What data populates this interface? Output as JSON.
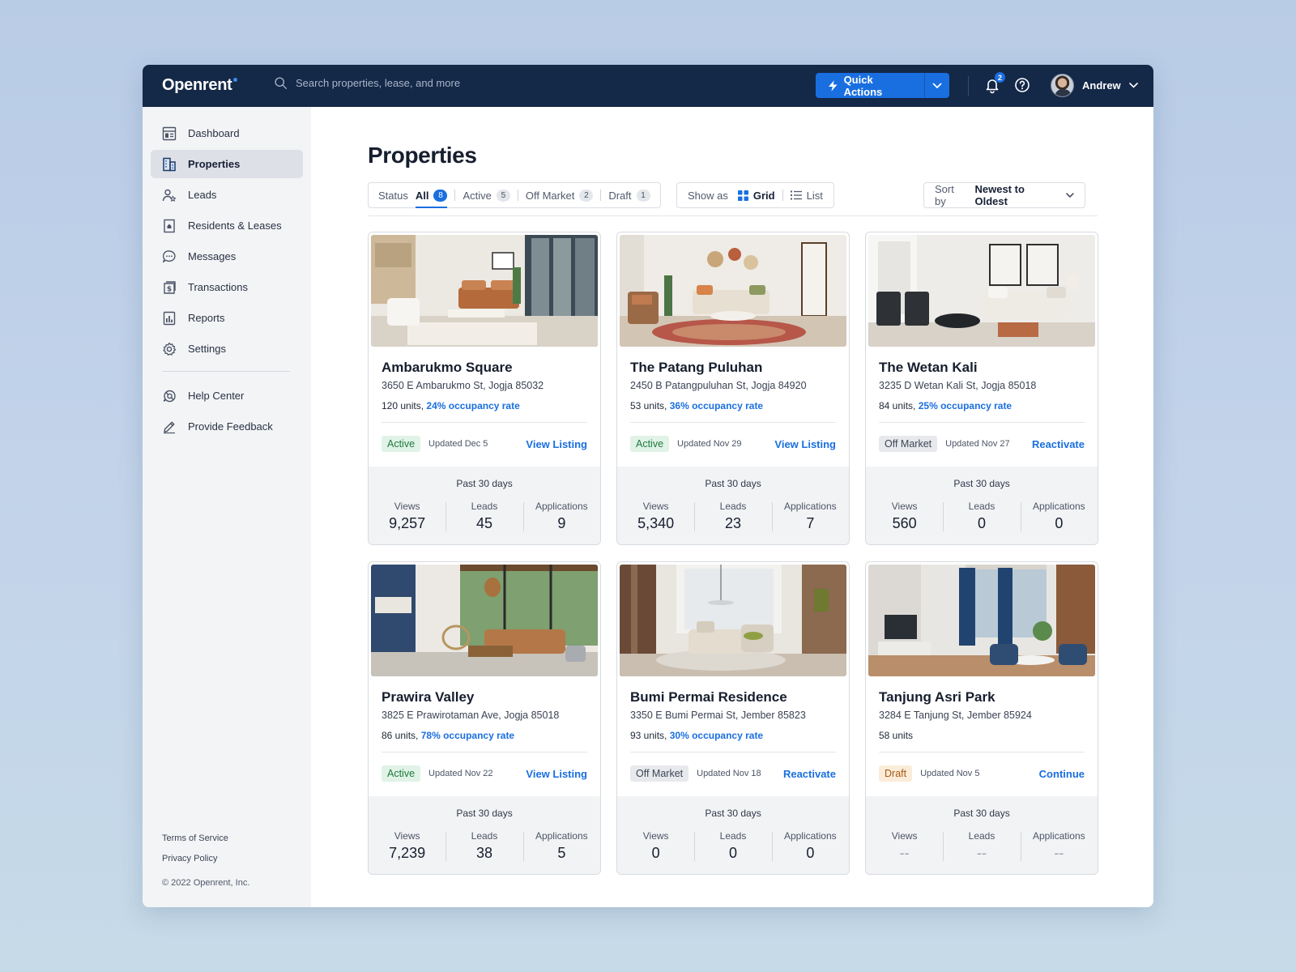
{
  "brand": {
    "name": "Openrent"
  },
  "search": {
    "placeholder": "Search properties, lease, and more"
  },
  "quick_actions": {
    "label": "Quick Actions"
  },
  "notifications": {
    "count": "2"
  },
  "user": {
    "name": "Andrew"
  },
  "sidebar": {
    "items": [
      {
        "label": "Dashboard",
        "icon": "dashboard-icon"
      },
      {
        "label": "Properties",
        "icon": "building-icon",
        "active": true
      },
      {
        "label": "Leads",
        "icon": "person-star-icon"
      },
      {
        "label": "Residents & Leases",
        "icon": "residence-icon"
      },
      {
        "label": "Messages",
        "icon": "chat-icon"
      },
      {
        "label": "Transactions",
        "icon": "dollar-icon"
      },
      {
        "label": "Reports",
        "icon": "report-icon"
      },
      {
        "label": "Settings",
        "icon": "gear-icon"
      }
    ],
    "secondary": [
      {
        "label": "Help Center",
        "icon": "help-center-icon"
      },
      {
        "label": "Provide Feedback",
        "icon": "pencil-icon"
      }
    ],
    "footer": {
      "terms": "Terms of Service",
      "privacy": "Privacy Policy",
      "copyright": "© 2022 Openrent, Inc."
    }
  },
  "page": {
    "title": "Properties",
    "status_label": "Status",
    "filters": [
      {
        "label": "All",
        "count": "8",
        "active": true
      },
      {
        "label": "Active",
        "count": "5"
      },
      {
        "label": "Off Market",
        "count": "2"
      },
      {
        "label": "Draft",
        "count": "1"
      }
    ],
    "show_as": {
      "label": "Show as",
      "grid": "Grid",
      "list": "List",
      "selected": "Grid"
    },
    "sort": {
      "label": "Sort by",
      "value": "Newest to Oldest"
    },
    "stats_period": "Past 30 days",
    "stat_labels": {
      "views": "Views",
      "leads": "Leads",
      "applications": "Applications"
    }
  },
  "properties": [
    {
      "name": "Ambarukmo Square",
      "address": "3650 E Ambarukmo St, Jogja 85032",
      "units": "120 units,",
      "occupancy": "24% occupancy rate",
      "status": "Active",
      "updated": "Updated Dec 5",
      "action": "View Listing",
      "views": "9,257",
      "leads": "45",
      "applications": "9"
    },
    {
      "name": "The Patang Puluhan",
      "address": "2450 B Patangpuluhan St, Jogja 84920",
      "units": "53 units,",
      "occupancy": "36% occupancy rate",
      "status": "Active",
      "updated": "Updated Nov 29",
      "action": "View Listing",
      "views": "5,340",
      "leads": "23",
      "applications": "7"
    },
    {
      "name": "The Wetan Kali",
      "address": "3235 D Wetan Kali St, Jogja 85018",
      "units": "84 units,",
      "occupancy": "25% occupancy rate",
      "status": "Off Market",
      "updated": "Updated Nov 27",
      "action": "Reactivate",
      "views": "560",
      "leads": "0",
      "applications": "0"
    },
    {
      "name": "Prawira Valley",
      "address": "3825 E Prawirotaman Ave, Jogja 85018",
      "units": "86 units,",
      "occupancy": "78% occupancy rate",
      "status": "Active",
      "updated": "Updated Nov 22",
      "action": "View Listing",
      "views": "7,239",
      "leads": "38",
      "applications": "5"
    },
    {
      "name": "Bumi Permai Residence",
      "address": "3350 E Bumi Permai St, Jember 85823",
      "units": "93 units,",
      "occupancy": "30% occupancy rate",
      "status": "Off Market",
      "updated": "Updated Nov 18",
      "action": "Reactivate",
      "views": "0",
      "leads": "0",
      "applications": "0"
    },
    {
      "name": "Tanjung Asri Park",
      "address": "3284 E Tanjung St, Jember 85924",
      "units": "58 units",
      "occupancy": "",
      "status": "Draft",
      "updated": "Updated Nov 5",
      "action": "Continue",
      "views": "--",
      "leads": "--",
      "applications": "--"
    }
  ]
}
